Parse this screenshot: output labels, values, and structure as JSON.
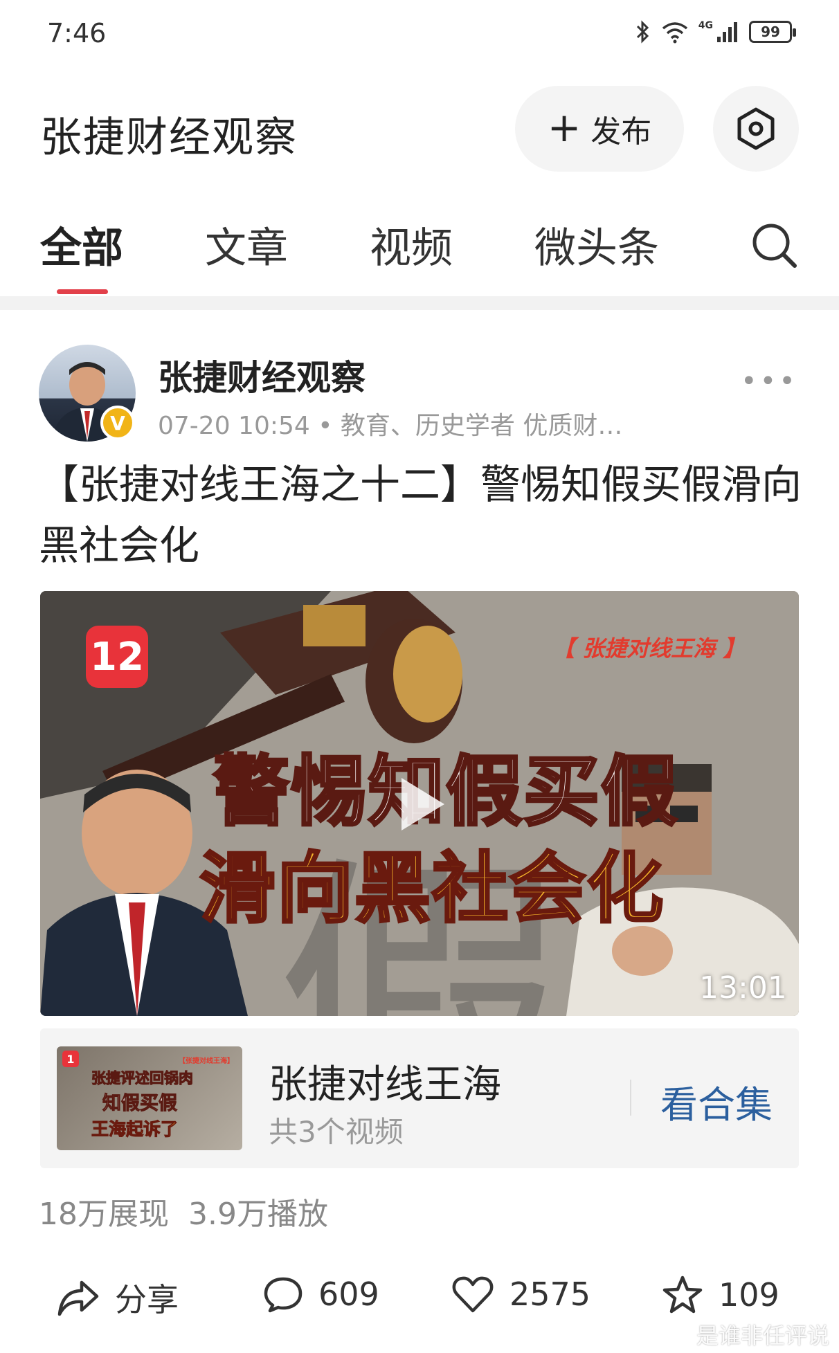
{
  "status": {
    "time": "7:46",
    "network": "4G",
    "battery": "99"
  },
  "header": {
    "title": "张捷财经观察",
    "publish_label": "发布"
  },
  "tabs": [
    {
      "label": "全部",
      "active": true
    },
    {
      "label": "文章",
      "active": false
    },
    {
      "label": "视频",
      "active": false
    },
    {
      "label": "微头条",
      "active": false
    }
  ],
  "post": {
    "author": "张捷财经观察",
    "meta": "07-20 10:54 • 教育、历史学者 优质财…",
    "title": "【张捷对线王海之十二】警惕知假买假滑向黑社会化",
    "video": {
      "badge": "12",
      "tag": "【 张捷对线王海 】",
      "line1": "警惕知假买假",
      "line2": "滑向黑社会化",
      "duration": "13:01"
    },
    "collection": {
      "thumb_badge": "1",
      "thumb_tag": "【张捷对线王海】",
      "thumb_line1": "张捷评述回锅肉",
      "thumb_line2": "知假买假",
      "thumb_line3": "王海起诉了",
      "title": "张捷对线王海",
      "count": "共3个视频",
      "link": "看合集"
    },
    "stats": {
      "impressions": "18万展现",
      "plays": "3.9万播放"
    },
    "actions": {
      "share": "分享",
      "comments": "609",
      "likes": "2575",
      "favorites": "109"
    }
  },
  "watermark": "是谁非任评说",
  "colors": {
    "accent_red": "#e2404a",
    "link_blue": "#2b5f9e",
    "badge_gold": "#f1b417"
  }
}
